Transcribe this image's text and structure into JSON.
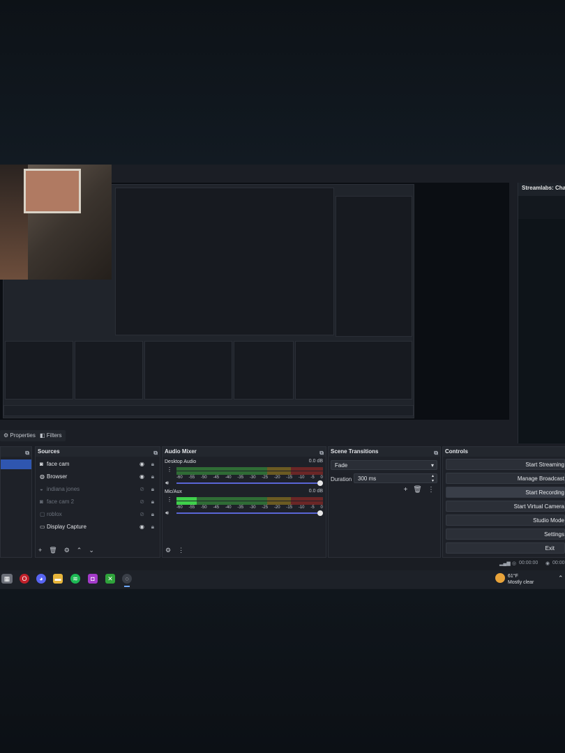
{
  "tabs": {
    "properties": "Properties",
    "filters": "Filters"
  },
  "chat": {
    "title": "Streamlabs: Chat"
  },
  "sources": {
    "title": "Sources",
    "items": [
      {
        "label": "face cam",
        "icon": "camera-icon",
        "visible": true
      },
      {
        "label": "Browser",
        "icon": "globe-icon",
        "visible": true
      },
      {
        "label": "indiana jones",
        "icon": "gamepad-icon",
        "visible": false
      },
      {
        "label": "face cam 2",
        "icon": "camera-icon",
        "visible": false
      },
      {
        "label": "roblox",
        "icon": "window-icon",
        "visible": false
      },
      {
        "label": "Display Capture",
        "icon": "monitor-icon",
        "visible": true
      }
    ]
  },
  "mixer": {
    "title": "Audio Mixer",
    "channels": [
      {
        "name": "Desktop Audio",
        "db": "0.0 dB",
        "level": 0
      },
      {
        "name": "Mic/Aux",
        "db": "0.0 dB",
        "level": 0.14
      }
    ],
    "ticks": [
      "-60",
      "-55",
      "-50",
      "-45",
      "-40",
      "-35",
      "-30",
      "-25",
      "-20",
      "-15",
      "-10",
      "-5",
      "0"
    ]
  },
  "transitions": {
    "title": "Scene Transitions",
    "selected": "Fade",
    "duration_label": "Duration",
    "duration": "300 ms"
  },
  "controls": {
    "title": "Controls",
    "buttons": [
      "Start Streaming",
      "Manage Broadcast",
      "Start Recording",
      "Start Virtual Camera",
      "Studio Mode",
      "Settings",
      "Exit"
    ]
  },
  "status": {
    "rec_time": "00:00:00",
    "stream_time": "00:00"
  },
  "weather": {
    "temp": "61°F",
    "desc": "Mostly clear"
  }
}
